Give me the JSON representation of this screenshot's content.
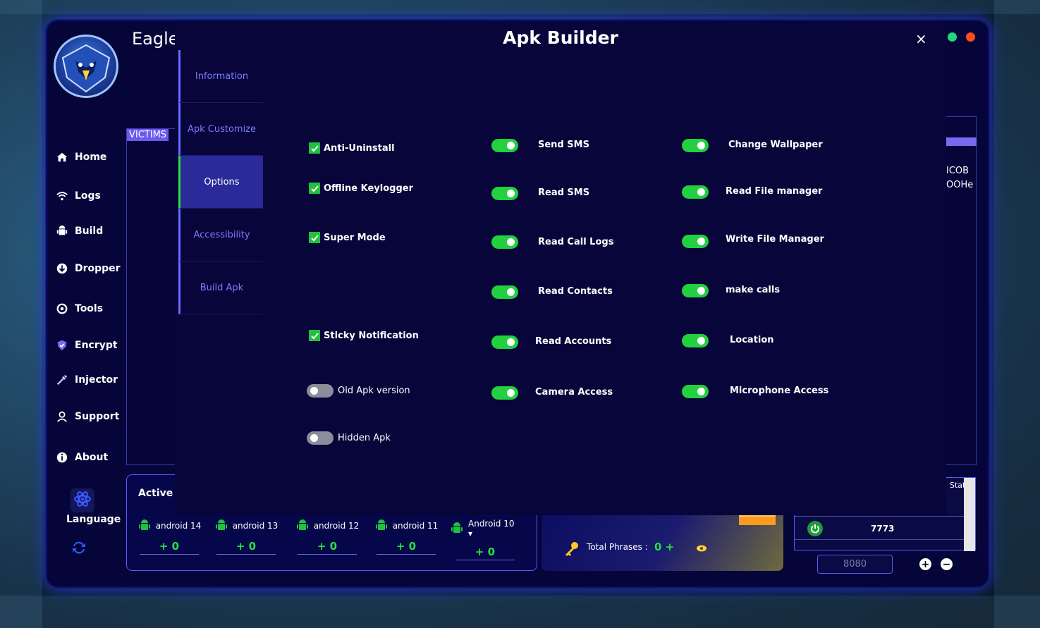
{
  "app": {
    "title": "Eagle",
    "window_dots": [
      "#22d67a",
      "#ff4a20"
    ]
  },
  "sidebar": {
    "items": [
      {
        "label": "Home",
        "icon": "home-icon"
      },
      {
        "label": "Logs",
        "icon": "wifi-icon"
      },
      {
        "label": "Build",
        "icon": "android-icon"
      },
      {
        "label": "Dropper",
        "icon": "download-icon"
      },
      {
        "label": "Tools",
        "icon": "tools-icon"
      },
      {
        "label": "Encrypt",
        "icon": "shield-icon"
      },
      {
        "label": "Injector",
        "icon": "syringe-icon"
      },
      {
        "label": "Support",
        "icon": "support-icon"
      },
      {
        "label": "About",
        "icon": "info-icon"
      }
    ],
    "language_label": "Language"
  },
  "main": {
    "victims_label": "VICTIMS",
    "right_fragments": [
      "ICOB",
      "OOHe"
    ],
    "active_devices": {
      "title": "Active D",
      "devices": [
        {
          "name": "android 14",
          "count": "+ 0"
        },
        {
          "name": "android 13",
          "count": "+ 0"
        },
        {
          "name": "android 12",
          "count": "+ 0"
        },
        {
          "name": "android 11",
          "count": "+ 0"
        },
        {
          "name": "Android 10 ▾",
          "count": "+ 0"
        }
      ]
    },
    "wallets": {
      "phrases_label": "Total Phrases :",
      "phrases_value": "0 +"
    },
    "ports": {
      "header": "Stat",
      "port_value": "7773",
      "input_value": "8080"
    }
  },
  "dialog": {
    "title": "Apk Builder",
    "close_label": "×",
    "tabs": [
      "Information",
      "Apk Customize",
      "Options",
      "Accessibility",
      "Build Apk"
    ],
    "active_tab": "Options",
    "checkboxes": [
      {
        "label": "Anti-Uninstall",
        "checked": true
      },
      {
        "label": "Offline Keylogger",
        "checked": true
      },
      {
        "label": "Super Mode",
        "checked": true
      },
      {
        "label": "Sticky Notification",
        "checked": true
      }
    ],
    "left_toggles": [
      {
        "label": "Old Apk version",
        "on": false
      },
      {
        "label": "Hidden Apk",
        "on": false
      }
    ],
    "mid_toggles": [
      {
        "label": "Send SMS",
        "on": true
      },
      {
        "label": "Read SMS",
        "on": true
      },
      {
        "label": "Read Call Logs",
        "on": true
      },
      {
        "label": "Read Contacts",
        "on": true
      },
      {
        "label": "Read Accounts",
        "on": true
      },
      {
        "label": "Camera Access",
        "on": true
      }
    ],
    "right_toggles": [
      {
        "label": "Change Wallpaper",
        "on": true
      },
      {
        "label": "Read File manager",
        "on": true
      },
      {
        "label": "Write File Manager",
        "on": true
      },
      {
        "label": "make calls",
        "on": true
      },
      {
        "label": "Location",
        "on": true
      },
      {
        "label": "Microphone Access",
        "on": true
      }
    ],
    "colors": {
      "toggle_on": "#22d040",
      "toggle_off": "#8c8c9a",
      "accent": "#7c7cff"
    }
  }
}
